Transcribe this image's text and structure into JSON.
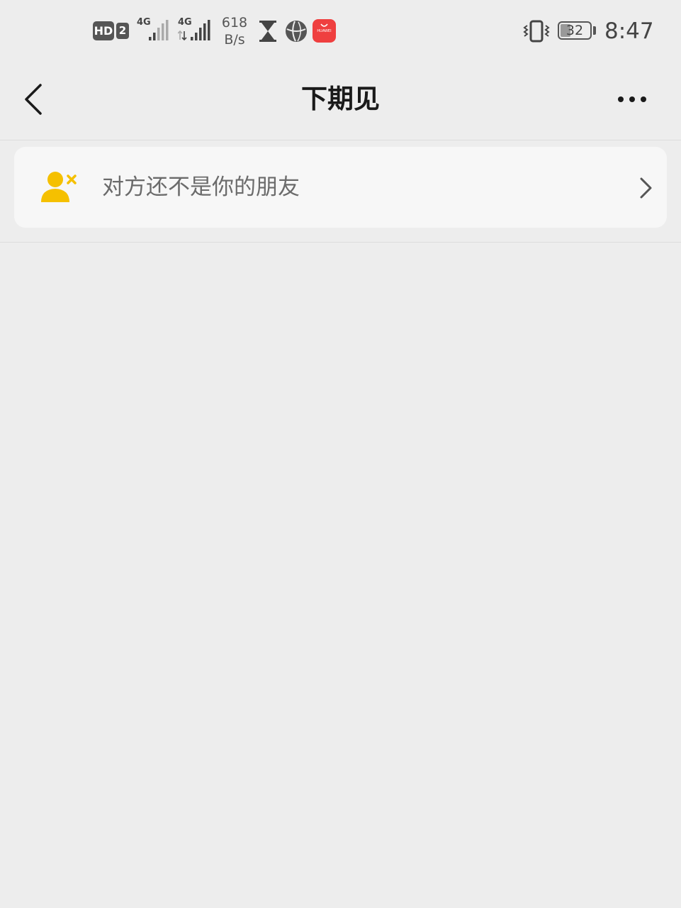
{
  "status_bar": {
    "hd": "HD",
    "sim": "2",
    "net1": "4G",
    "net2": "4G",
    "speed_value": "618",
    "speed_unit": "B/s",
    "battery": "32",
    "time": "8:47",
    "app_icon_text": "HUAWEI"
  },
  "header": {
    "title": "下期见"
  },
  "banner": {
    "text": "对方还不是你的朋友",
    "icon_color": "#f5c000"
  },
  "colors": {
    "background": "#ededed",
    "banner_bg": "#f7f7f7",
    "accent_red": "#ef3f3f"
  }
}
